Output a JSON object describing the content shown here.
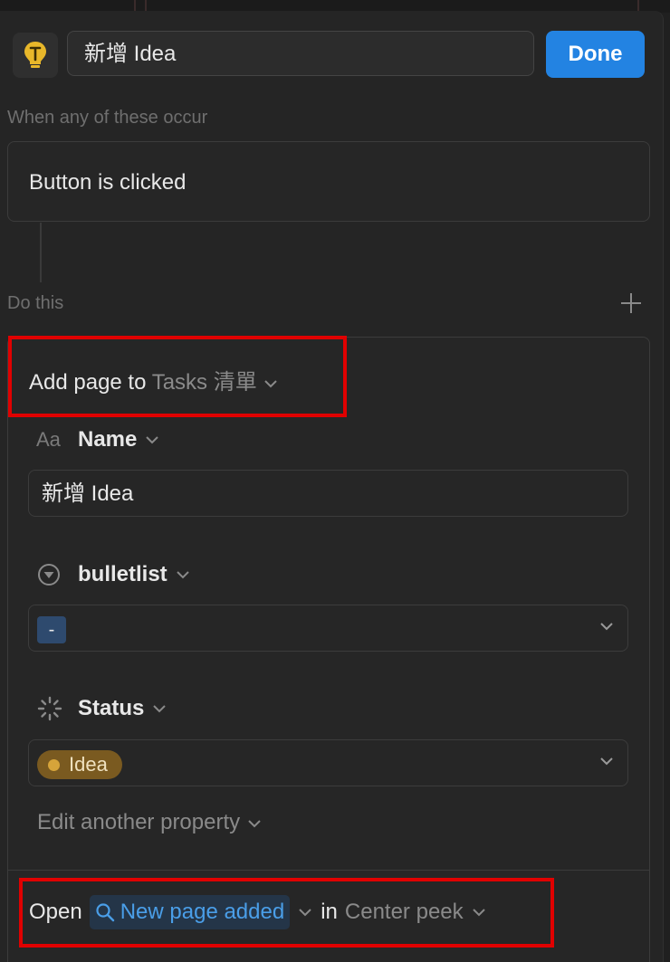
{
  "header": {
    "title_value": "新增 Idea",
    "done_label": "Done"
  },
  "trigger": {
    "section_label": "When any of these occur",
    "item": "Button is clicked"
  },
  "action": {
    "section_label": "Do this",
    "prefix": "Add page to",
    "database": "Tasks 清單",
    "properties": [
      {
        "name": "Name",
        "icon": "text-aa-icon",
        "value": "新增 Idea"
      },
      {
        "name": "bulletlist",
        "icon": "select-circle-icon",
        "value": "-"
      },
      {
        "name": "Status",
        "icon": "status-spinner-icon",
        "value": "Idea"
      }
    ],
    "name_icon_text": "Aa",
    "edit_another": "Edit another property"
  },
  "open": {
    "prefix": "Open",
    "target": "New page added",
    "in_word": "in",
    "mode": "Center peek"
  },
  "colors": {
    "accent": "#2383e2",
    "highlight": "#e00000",
    "status_idea": "#d6a43a"
  }
}
